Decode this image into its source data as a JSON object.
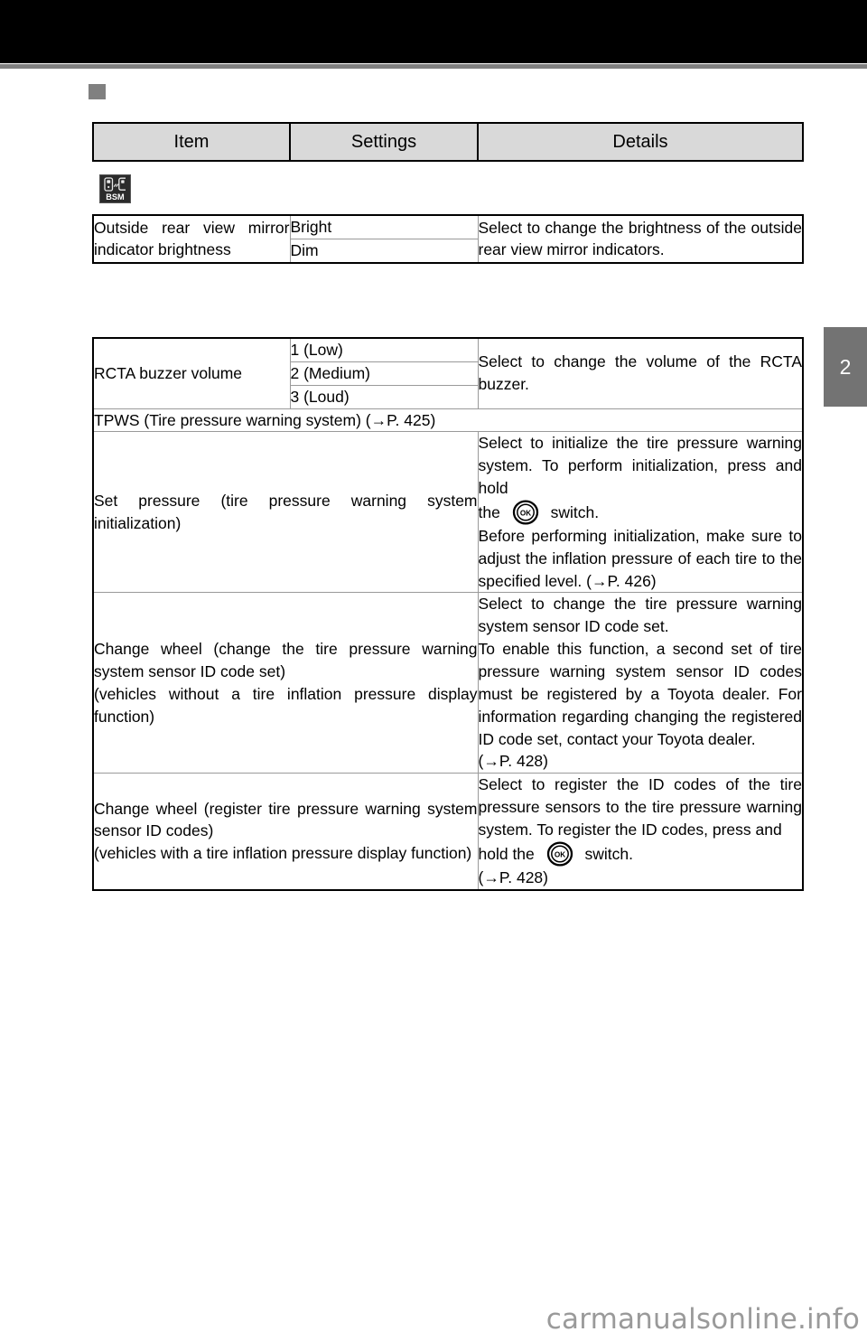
{
  "page": {
    "chapter_tab": "2",
    "watermark": "carmanualsonline.info"
  },
  "table_header": {
    "item": "Item",
    "settings": "Settings",
    "details": "Details"
  },
  "group_icon": {
    "name": "bsm-icon",
    "label": "BSM"
  },
  "tables": [
    {
      "rows": [
        {
          "item": "Outside rear view mirror indicator brightness",
          "settings": [
            "Bright",
            "Dim"
          ],
          "details": "Select to change the brightness of the outside rear view mirror indicators."
        }
      ]
    },
    {
      "rows": [
        {
          "item": "RCTA buzzer volume",
          "settings": [
            "1 (Low)",
            "2 (Medium)",
            "3 (Loud)"
          ],
          "details": "Select to change the volume of the RCTA buzzer."
        }
      ],
      "section_row": "TPWS (Tire pressure warning system) (→P. 425)",
      "full_rows": [
        {
          "item": "Set pressure (tire pressure warning system initialization)",
          "details_part1": "Select to initialize the tire pressure warning system. To perform initialization, press and hold",
          "details_inline_pre": "the",
          "details_icon": "ok-switch-icon",
          "details_inline_post": "switch.",
          "details_part2": "Before performing initialization, make sure to adjust the inflation pressure of each tire to the specified level. (→P. 426)"
        },
        {
          "item": "Change wheel (change the tire pressure warning system sensor ID code set)\n(vehicles without a tire inflation pressure display function)",
          "details": "Select to change the tire pressure warning system sensor ID code set.\nTo enable this function, a second set of tire pressure warning system sensor ID codes must be registered by a Toyota dealer. For information regarding changing the registered ID code set, contact your Toyota dealer.\n(→P. 428)"
        },
        {
          "item": "Change wheel (register tire pressure warning system sensor ID codes)\n(vehicles with a tire inflation pressure display function)",
          "details_part1": "Select to register the ID codes of the tire pressure sensors to the tire pressure warning system. To register the ID codes, press and",
          "details_inline_pre": "hold the",
          "details_icon": "ok-switch-icon",
          "details_inline_post": "switch.",
          "details_part2": "(→P. 428)"
        }
      ]
    }
  ],
  "colors": {
    "banner": "#000000",
    "rule": "#808080",
    "header_bg": "#d9d9d9",
    "tab_bg": "#737373",
    "watermark": "#9a9a9a"
  }
}
